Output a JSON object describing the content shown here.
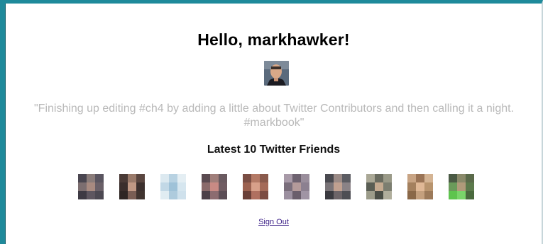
{
  "greeting": "Hello, markhawker!",
  "status_text": "\"Finishing up editing #ch4 by adding a little about Twitter Contributors and then calling it a night. #markbook\"",
  "friends": {
    "heading": "Latest 10 Twitter Friends",
    "avatar_icons": [
      "friend-avatar-1-icon",
      "friend-avatar-2-icon",
      "friend-avatar-3-icon",
      "friend-avatar-4-icon",
      "friend-avatar-5-icon",
      "friend-avatar-6-icon",
      "friend-avatar-7-icon",
      "friend-avatar-8-icon",
      "friend-avatar-9-icon",
      "friend-avatar-10-icon"
    ]
  },
  "sign_out_label": "Sign Out",
  "colors": {
    "frame_border": "#1f8a9b",
    "status_text": "#b9b9b9",
    "link": "#3b1f87"
  }
}
